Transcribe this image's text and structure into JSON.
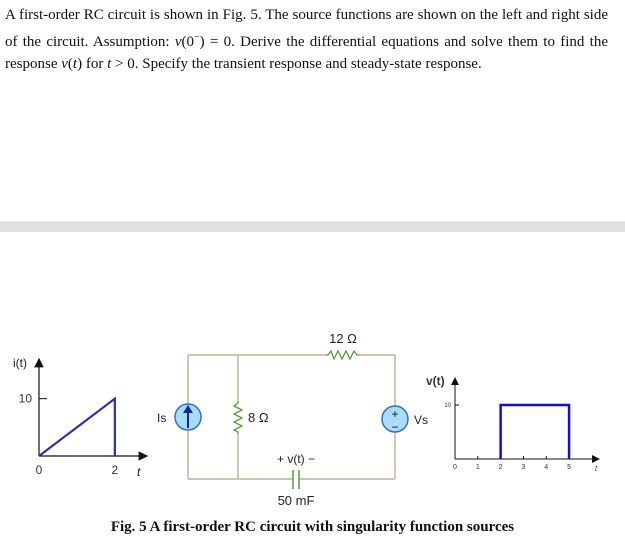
{
  "problem": {
    "text_parts": {
      "p1": "A first-order RC circuit is shown in Fig. 5. The source functions are shown on the left and right side of the circuit. Assumption: ",
      "v0": "v",
      "v0_arg": "(0",
      "v0_sup": "−",
      "v0_end": ") = 0. Derive the differential equations and solve them to find the response ",
      "vt": "v",
      "vt_arg": "(",
      "vt_t": "t",
      "vt_end": ") for ",
      "t": "t",
      "p_end": " > 0. Specify the transient response and steady-state response."
    }
  },
  "circuit": {
    "current_source_label": "Is",
    "resistor1_label": "8 Ω",
    "resistor2_label": "12 Ω",
    "voltage_source_label": "Vs",
    "voltage_plus": "+",
    "voltage_minus": "−",
    "capacitor_label": "50 mF",
    "capacitor_voltage_label": "+ v(t) −",
    "wire_color": "#c8b09a",
    "component_color": "#5a9a3a",
    "source_fill": "#a9dcf7",
    "source_stroke": "#2a6fd6"
  },
  "caption": "Fig. 5 A first-order RC circuit with singularity function sources",
  "chart_data": [
    {
      "type": "line",
      "title": "",
      "ylabel": "i(t)",
      "xlabel": "t",
      "x_ticks": [
        0,
        2
      ],
      "y_ticks": [
        10
      ],
      "xlim": [
        0,
        2.9
      ],
      "ylim": [
        0,
        15
      ],
      "series": [
        {
          "name": "i(t)",
          "x": [
            0,
            2,
            2
          ],
          "y": [
            0,
            10,
            0
          ],
          "color": "#2b2fb8"
        }
      ],
      "grid": false
    },
    {
      "type": "line",
      "title": "",
      "ylabel": "v(t)",
      "xlabel": "t",
      "x_ticks": [
        0,
        1,
        2,
        3,
        4,
        5
      ],
      "y_ticks": [
        10
      ],
      "xlim": [
        0,
        6.4
      ],
      "ylim": [
        0,
        15
      ],
      "series": [
        {
          "name": "v(t)",
          "x": [
            2,
            2,
            5,
            5
          ],
          "y": [
            0,
            10,
            10,
            0
          ],
          "color": "#1010d0"
        }
      ],
      "grid": false
    }
  ]
}
